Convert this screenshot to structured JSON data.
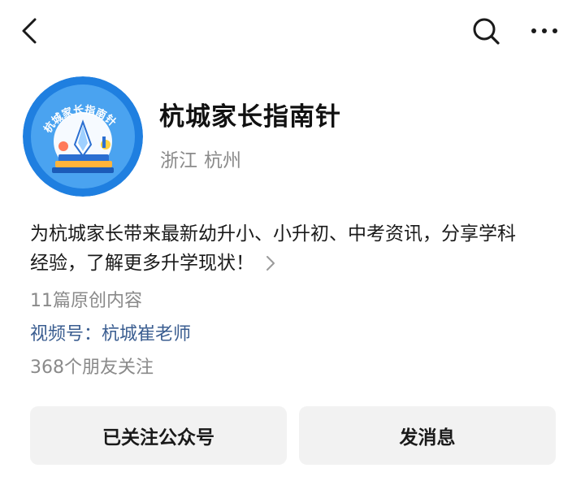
{
  "profile": {
    "name": "杭城家长指南针",
    "province": "浙江",
    "city": "杭州",
    "avatar_text": "杭城家长指南针",
    "intro_line1": "为杭城家长带来最新幼升小、小升初、中考资讯，分享学科",
    "intro_line2": "经验，了解更多升学现状！",
    "original_count": "11篇原创内容",
    "channel": "视频号：杭城崔老师",
    "followers": "368个朋友关注"
  },
  "actions": {
    "follow_label": "已关注公众号",
    "message_label": "发消息"
  },
  "icons": {
    "back": "chevron-left-icon",
    "search": "search-icon",
    "more": "more-icon",
    "intro_more": "chevron-right-icon"
  },
  "colors": {
    "link": "#3a5d90",
    "secondary_text": "#8a8a8a",
    "button_bg": "#f2f2f2",
    "avatar_blue": "#1f7fe0"
  }
}
